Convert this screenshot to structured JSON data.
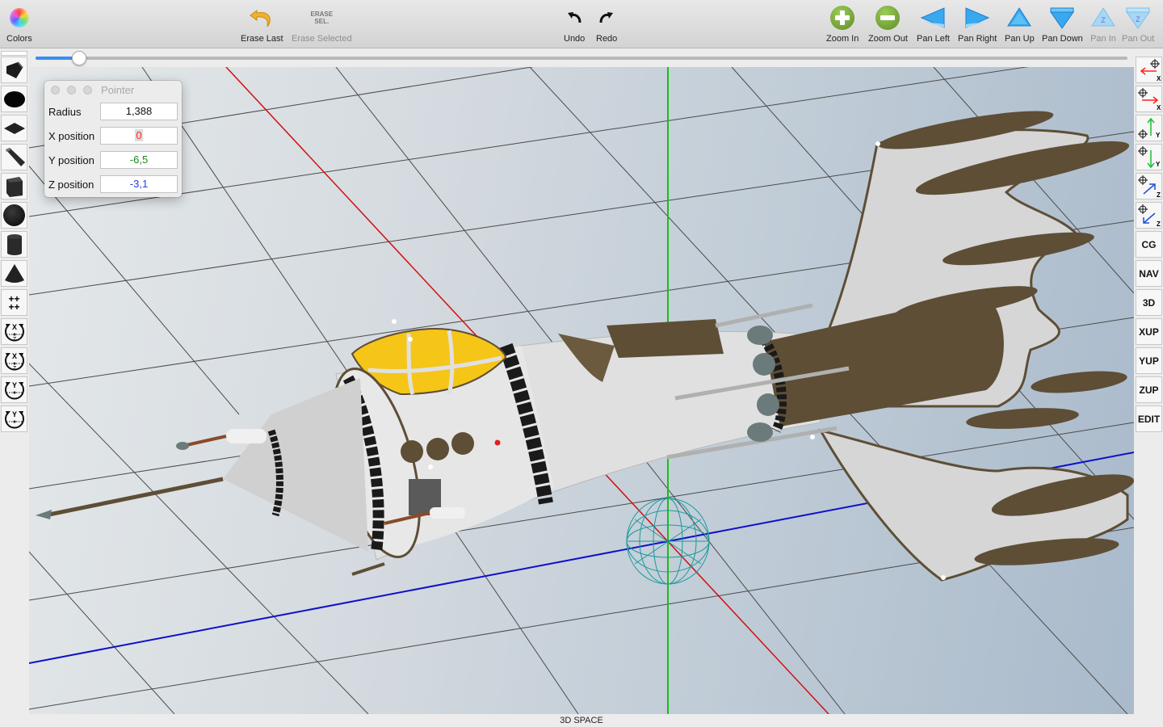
{
  "toolbar": {
    "colors": {
      "label": "Colors",
      "icon": "color-wheel-icon"
    },
    "erase_last": {
      "label": "Erase Last",
      "icon": "undo-arrow-icon"
    },
    "erase_selected": {
      "label": "Erase Selected",
      "icon_text": "ERASE\nSEL.",
      "icon_line1": "ERASE",
      "icon_line2": "SEL.",
      "disabled": true
    },
    "undo": {
      "label": "Undo",
      "icon": "undo-icon"
    },
    "redo": {
      "label": "Redo",
      "icon": "redo-icon"
    },
    "zoom_in": {
      "label": "Zoom In",
      "icon": "zoom-in-icon"
    },
    "zoom_out": {
      "label": "Zoom Out",
      "icon": "zoom-out-icon"
    },
    "pan_left": {
      "label": "Pan Left",
      "icon": "pan-left-icon"
    },
    "pan_right": {
      "label": "Pan Right",
      "icon": "pan-right-icon"
    },
    "pan_up": {
      "label": "Pan Up",
      "icon": "pan-up-icon"
    },
    "pan_down": {
      "label": "Pan Down",
      "icon": "pan-down-icon"
    },
    "pan_in": {
      "label": "Pan In",
      "icon": "pan-in-icon",
      "glyph": "Z",
      "disabled": true
    },
    "pan_out": {
      "label": "Pan Out",
      "icon": "pan-out-icon",
      "glyph": "Z",
      "disabled": true
    }
  },
  "slider": {
    "value_fraction": 0.04
  },
  "left_palette": {
    "tools": [
      {
        "name": "curved-surface-tool",
        "icon": "curved-surface-icon"
      },
      {
        "name": "ellipse-tool",
        "icon": "ellipse-icon"
      },
      {
        "name": "flat-plane-tool",
        "icon": "plane-icon"
      },
      {
        "name": "bar-tool",
        "icon": "bar-icon"
      },
      {
        "name": "cube-tool",
        "icon": "cube-icon"
      },
      {
        "name": "sphere-tool",
        "icon": "sphere-icon"
      },
      {
        "name": "cylinder-tool",
        "icon": "cylinder-icon"
      },
      {
        "name": "cone-tool",
        "icon": "cone-icon"
      },
      {
        "name": "grid-plus-tool",
        "icon": "plus-grid-icon",
        "glyph": "++\n++"
      },
      {
        "name": "rotate-xz-cw-tool",
        "icon": "rotate-xz-icon",
        "top": "X",
        "bottom": "Z"
      },
      {
        "name": "rotate-xz-ccw-tool",
        "icon": "rotate-xz-icon",
        "top": "X",
        "bottom": "Z"
      },
      {
        "name": "rotate-y-cw-tool",
        "icon": "rotate-y-icon",
        "top": "Y",
        "bottom": ""
      },
      {
        "name": "rotate-y-ccw-tool",
        "icon": "rotate-y-icon",
        "top": "Y",
        "bottom": ""
      }
    ]
  },
  "right_palette": {
    "move_buttons": [
      {
        "name": "move-neg-x",
        "axis": "X",
        "color": "#ff2020",
        "dir": "left"
      },
      {
        "name": "move-pos-x",
        "axis": "X",
        "color": "#ff2020",
        "dir": "right"
      },
      {
        "name": "move-pos-y",
        "axis": "Y",
        "color": "#18c030",
        "dir": "up"
      },
      {
        "name": "move-neg-y",
        "axis": "Y",
        "color": "#18c030",
        "dir": "down"
      },
      {
        "name": "move-pos-z",
        "axis": "Z",
        "color": "#1e4ee0",
        "dir": "upright"
      },
      {
        "name": "move-neg-z",
        "axis": "Z",
        "color": "#1e4ee0",
        "dir": "downleft"
      }
    ],
    "text_buttons": [
      "CG",
      "NAV",
      "3D",
      "XUP",
      "YUP",
      "ZUP",
      "EDIT"
    ]
  },
  "pointer_panel": {
    "title": "Pointer",
    "fields": [
      {
        "label": "Radius",
        "value": "1,388",
        "color": "#111111"
      },
      {
        "label": "X position",
        "value": "0",
        "color": "#ff2a2a"
      },
      {
        "label": "Y position",
        "value": "-6,5",
        "color": "#1a8a1a"
      },
      {
        "label": "Z position",
        "value": "-3,1",
        "color": "#2040e8"
      }
    ]
  },
  "viewport": {
    "axis_colors": {
      "x": "#d01010",
      "y": "#14c014",
      "z": "#1010c8"
    },
    "pointer_color": "#1a9a9a",
    "model_colors": {
      "hull": "#d8d8d8",
      "trim": "#5e4e36",
      "canopy": "#f5c518",
      "bands": "#1a1a1a"
    }
  },
  "status": {
    "label": "3D SPACE"
  }
}
